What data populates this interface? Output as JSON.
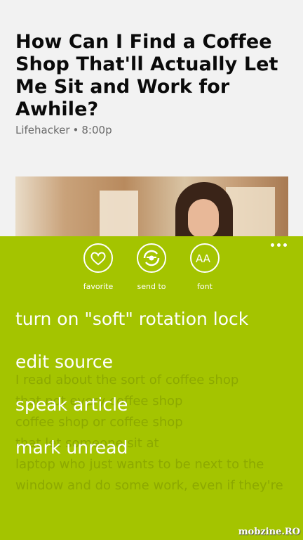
{
  "article": {
    "title": "How Can I Find a Coffee Shop That'll Actually Let Me Sit and Work for Awhile?",
    "source": "Lifehacker",
    "separator": "•",
    "time": "8:00p"
  },
  "app_bar": {
    "background_color": "#a4c400",
    "more_icon": "ellipsis-icon",
    "buttons": [
      {
        "label": "favorite",
        "icon": "heart-icon"
      },
      {
        "label": "send to",
        "icon": "share-icon"
      },
      {
        "label": "font",
        "icon": "font-icon",
        "glyph": "AA"
      }
    ],
    "menu_items": [
      "turn on \"soft\" rotation lock",
      "edit source",
      "speak article",
      "mark unread"
    ]
  },
  "watermark": "mobzine.RO"
}
